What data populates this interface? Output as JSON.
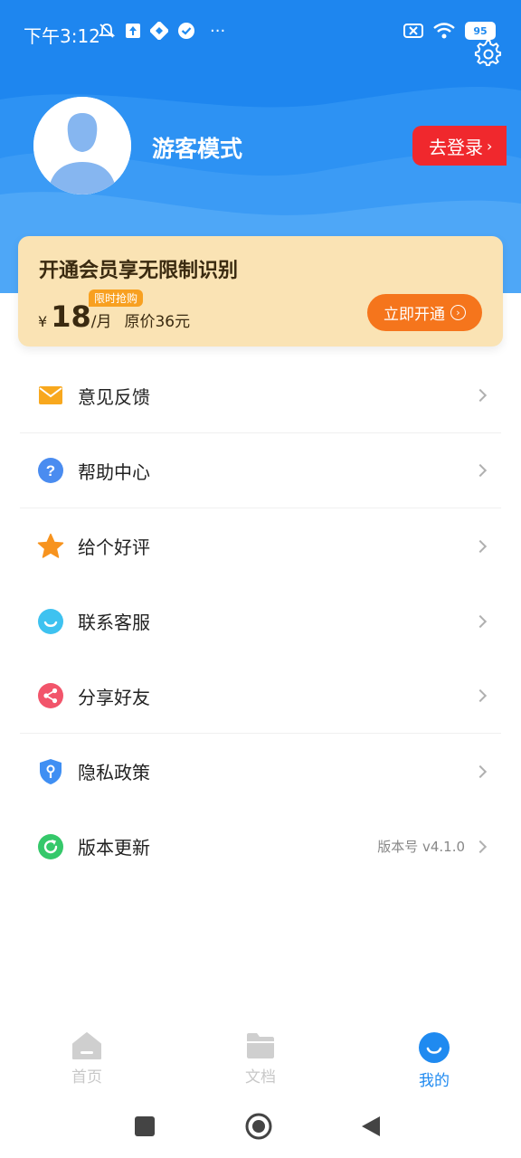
{
  "status_bar": {
    "time": "下午3:12",
    "more": "···",
    "battery": "95"
  },
  "profile": {
    "name": "游客模式",
    "login_label": "去登录"
  },
  "vip": {
    "title": "开通会员享无限制识别",
    "badge": "限时抢购",
    "currency": "¥",
    "price": "18",
    "unit": "/月",
    "original": "原价36元",
    "button_label": "立即开通"
  },
  "menu": {
    "items": [
      {
        "label": "意见反馈",
        "icon": "mail-icon",
        "color": "#f8a81e"
      },
      {
        "label": "帮助中心",
        "icon": "help-icon",
        "color": "#4a8cf0"
      },
      {
        "label": "给个好评",
        "icon": "star-icon",
        "color": "#f7931e"
      },
      {
        "label": "联系客服",
        "icon": "customer-service-icon",
        "color": "#3ec2f0"
      },
      {
        "label": "分享好友",
        "icon": "share-icon",
        "color": "#f2556b"
      },
      {
        "label": "隐私政策",
        "icon": "shield-icon",
        "color": "#3f8ff3"
      },
      {
        "label": "版本更新",
        "icon": "refresh-icon",
        "color": "#35c86a"
      }
    ],
    "version_label": "版本号 v4.1.0"
  },
  "tabs": [
    {
      "label": "首页",
      "icon": "home-icon",
      "active": false
    },
    {
      "label": "文档",
      "icon": "folder-icon",
      "active": false
    },
    {
      "label": "我的",
      "icon": "profile-face-icon",
      "active": true
    }
  ],
  "colors": {
    "brand": "#1f8af0",
    "login_red": "#f0282d",
    "vip_bg": "#fae3b4",
    "vip_button": "#f5751c"
  }
}
